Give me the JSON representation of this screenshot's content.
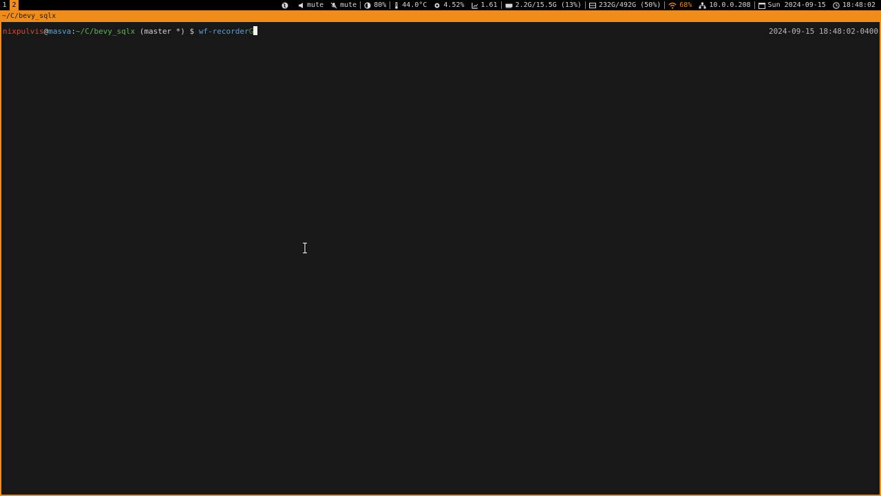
{
  "topbar": {
    "workspaces": [
      "1",
      "2"
    ],
    "active_workspace": "2",
    "status": {
      "network_icon": "globe-icon",
      "speaker": "mute",
      "mic": "mute",
      "brightness": "80%",
      "temperature": "44.0°C",
      "cpu": "4.52%",
      "load": "1.61",
      "memory": "2.2G/15.5G (13%)",
      "disk": "232G/492G (50%)",
      "wifi": "68%",
      "ip": "10.0.0.208",
      "date": "Sun 2024-09-15",
      "time": "18:48:02"
    }
  },
  "window": {
    "title": "~/C/bevy_sqlx"
  },
  "terminal": {
    "prompt": {
      "user": "nixpulvis",
      "at": "@",
      "host": "masva",
      "colon": ":",
      "path": "~/C/bevy_sqlx",
      "git": " (master *)",
      "symbol": " $ ",
      "command": "wf-recorder",
      "suggestion": "G"
    },
    "timestamp": "2024-09-15 18:48:02-0400"
  },
  "colors": {
    "accent": "#f08c1a",
    "background": "#181818",
    "user": "#e2473b",
    "host": "#58a6d6",
    "path": "#5fb35a"
  }
}
